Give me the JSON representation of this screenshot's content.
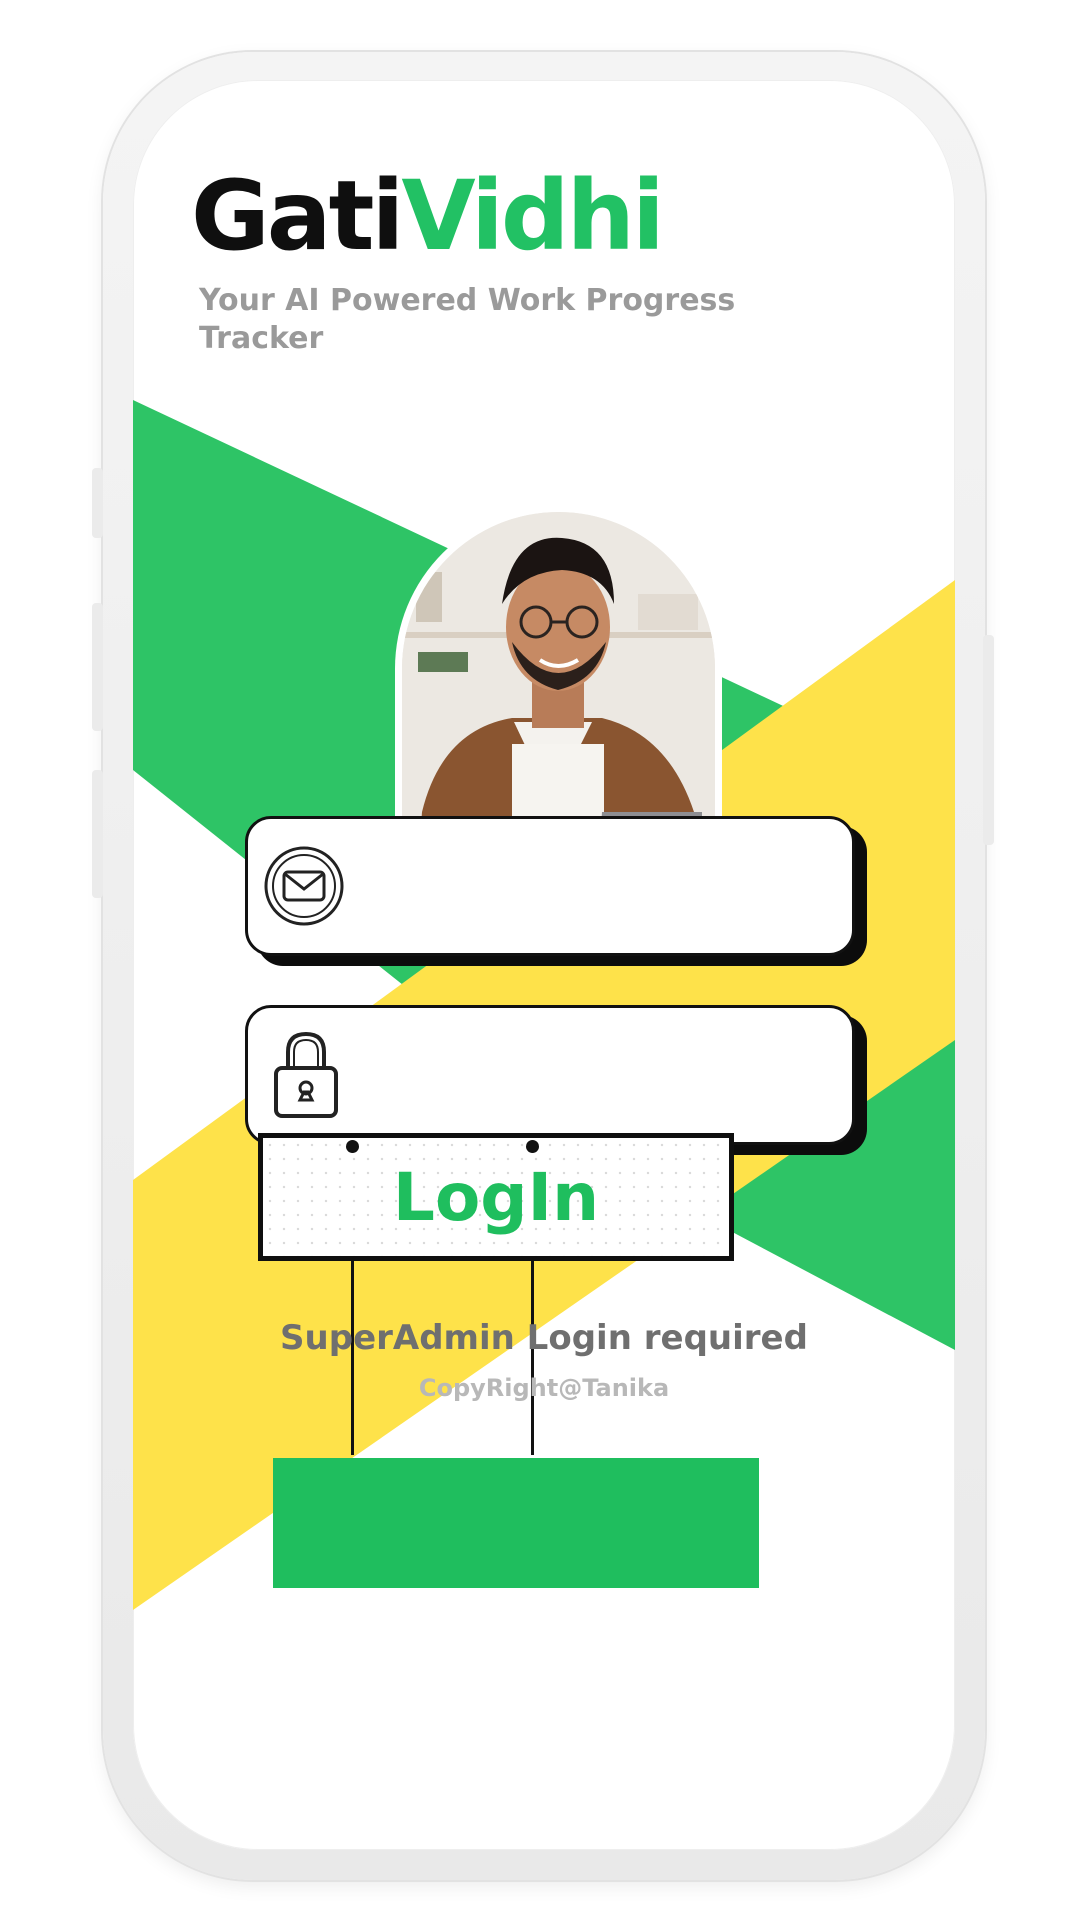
{
  "app": {
    "brand_part1": "Gati",
    "brand_part2": "Vidhi",
    "tagline": "Your AI Powered Work Progress Tracker"
  },
  "form": {
    "email_value": "",
    "password_value": "",
    "email_icon": "mail-icon",
    "password_icon": "lock-icon",
    "login_label": "LogIn"
  },
  "footer": {
    "note": "SuperAdmin Login required",
    "copyright": "CopyRight@Tanika"
  },
  "colors": {
    "brand_dark": "#0f0f0f",
    "brand_green": "#22c164",
    "band_green": "#2ec466",
    "band_yellow": "#fee24a",
    "muted_text": "#9a9a9a"
  }
}
